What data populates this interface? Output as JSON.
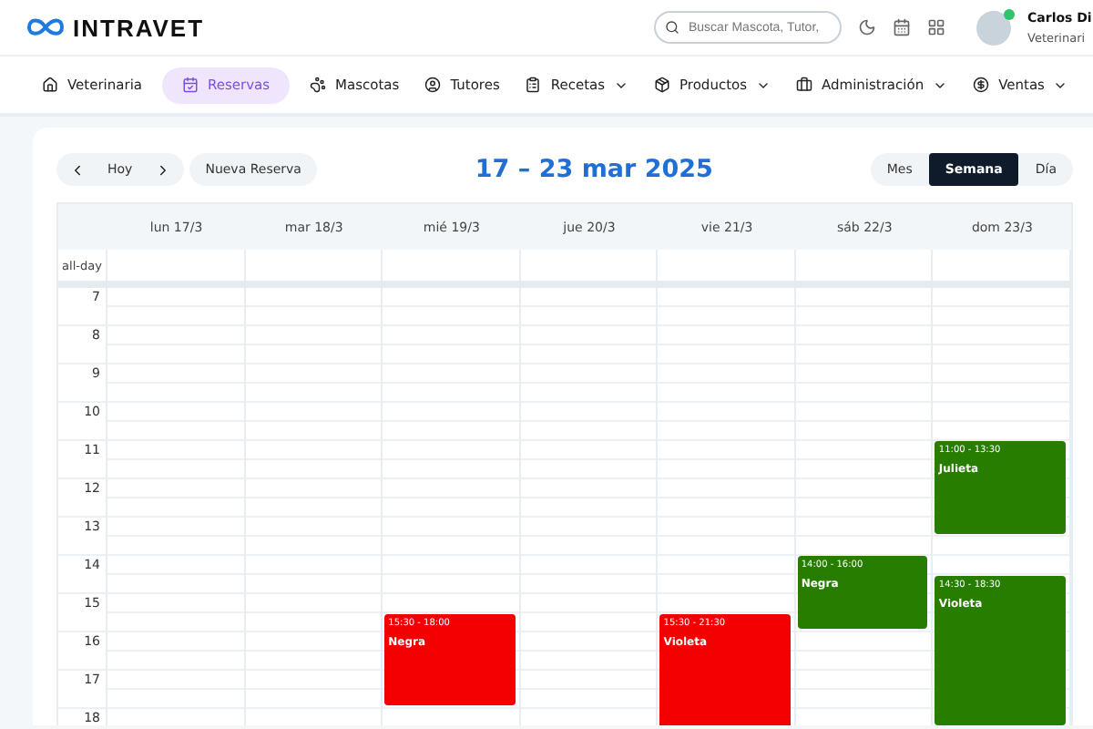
{
  "brand": {
    "name": "INTRAVET"
  },
  "search": {
    "placeholder": "Buscar Mascota, Tutor,"
  },
  "user": {
    "name": "Carlos Di",
    "role": "Veterinari",
    "online": true
  },
  "nav": [
    {
      "label": "Veterinaria",
      "selected": false,
      "dropdown": false
    },
    {
      "label": "Reservas",
      "selected": true,
      "dropdown": false
    },
    {
      "label": "Mascotas",
      "selected": false,
      "dropdown": false
    },
    {
      "label": "Tutores",
      "selected": false,
      "dropdown": false
    },
    {
      "label": "Recetas",
      "selected": false,
      "dropdown": true
    },
    {
      "label": "Productos",
      "selected": false,
      "dropdown": true
    },
    {
      "label": "Administración",
      "selected": false,
      "dropdown": true
    },
    {
      "label": "Ventas",
      "selected": false,
      "dropdown": true
    }
  ],
  "toolbar": {
    "today": "Hoy",
    "new": "Nueva Reserva",
    "title": "17 – 23 mar 2025",
    "views": [
      {
        "label": "Mes",
        "selected": false
      },
      {
        "label": "Semana",
        "selected": true
      },
      {
        "label": "Día",
        "selected": false
      }
    ]
  },
  "calendar": {
    "all_day": "all-day",
    "hours": [
      "7",
      "8",
      "9",
      "10",
      "11",
      "12",
      "13",
      "14",
      "15",
      "16",
      "17",
      "18"
    ],
    "days": [
      {
        "label": "lun 17/3"
      },
      {
        "label": "mar 18/3"
      },
      {
        "label": "mié 19/3",
        "events": [
          {
            "time": "15:30 - 18:00",
            "title": "Negra",
            "color": "#f50000"
          }
        ]
      },
      {
        "label": "jue 20/3"
      },
      {
        "label": "vie 21/3",
        "events": [
          {
            "time": "15:30 - 21:30",
            "title": "Violeta",
            "color": "#f50000"
          }
        ]
      },
      {
        "label": "sáb 22/3",
        "events": [
          {
            "time": "14:00 - 16:00",
            "title": "Negra",
            "color": "#267d00"
          }
        ]
      },
      {
        "label": "dom 23/3",
        "events": [
          {
            "time": "11:00 - 13:30",
            "title": "Julieta",
            "color": "#267d00"
          },
          {
            "time": "14:30 - 18:30",
            "title": "Violeta",
            "color": "#267d00"
          }
        ]
      }
    ]
  }
}
